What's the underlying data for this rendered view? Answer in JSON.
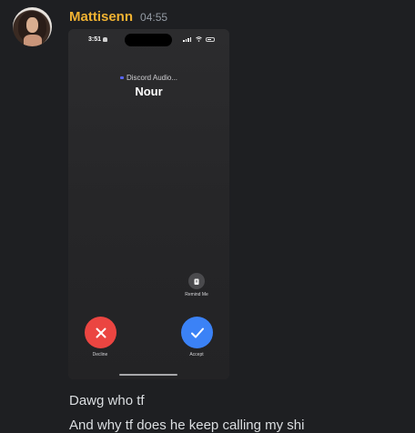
{
  "author": {
    "username": "Mattisenn",
    "timestamp": "04:55",
    "avatar_icon": "user-avatar-photo",
    "username_color": "#f0b232"
  },
  "attachment": {
    "status_bar": {
      "time": "3:51"
    },
    "call": {
      "app_label": "Discord Audio...",
      "caller_name": "Nour",
      "remind_label": "Remind Me",
      "decline_label": "Decline",
      "accept_label": "Accept",
      "decline_color": "#eb4541",
      "accept_color": "#3b82f6"
    }
  },
  "message": {
    "lines": [
      "Dawg who tf",
      "And why tf does he keep calling my shi"
    ]
  }
}
